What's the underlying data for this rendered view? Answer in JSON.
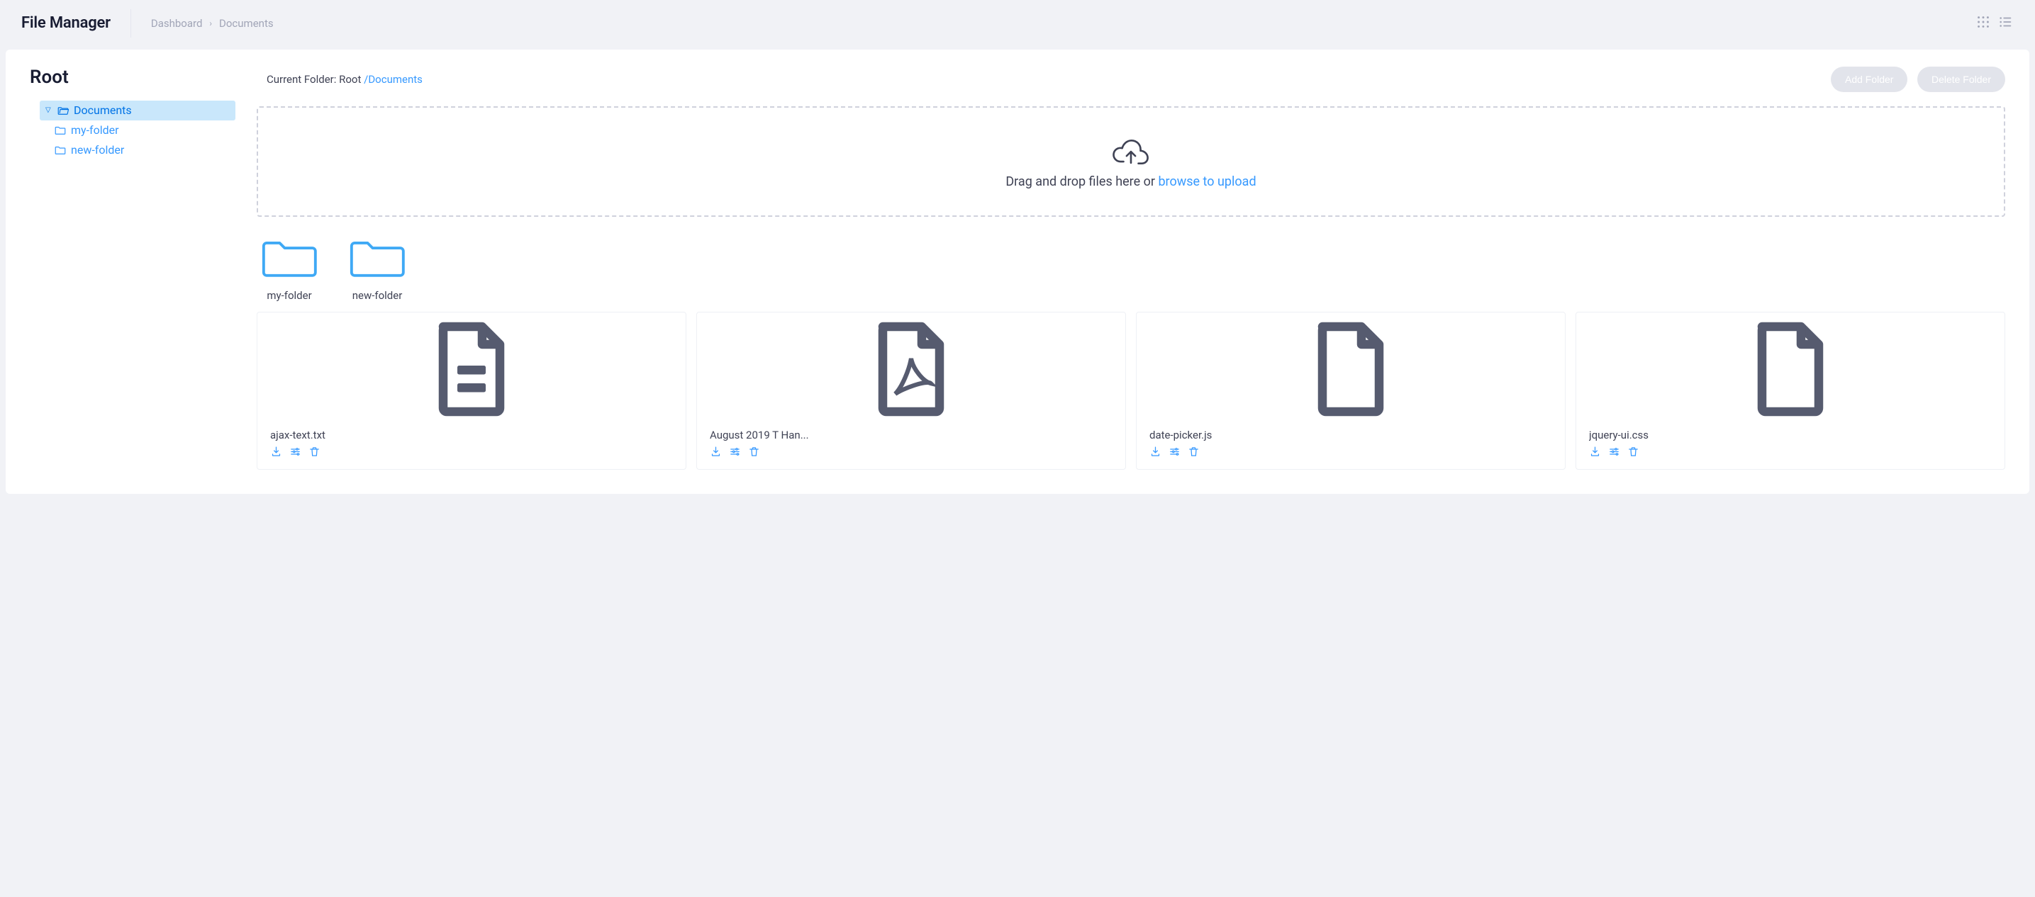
{
  "header": {
    "title": "File Manager",
    "breadcrumb": [
      "Dashboard",
      "Documents"
    ]
  },
  "sidebar": {
    "root_label": "Root",
    "tree": {
      "label": "Documents",
      "selected": true,
      "children": [
        {
          "label": "my-folder"
        },
        {
          "label": "new-folder"
        }
      ]
    }
  },
  "main": {
    "path_prefix": "Current Folder: Root ",
    "path_segments": [
      "Documents"
    ],
    "buttons": {
      "add_folder": "Add Folder",
      "delete_folder": "Delete Folder"
    },
    "dropzone": {
      "text": "Drag and drop files here or ",
      "link": "browse to upload"
    },
    "folders": [
      {
        "name": "my-folder"
      },
      {
        "name": "new-folder"
      }
    ],
    "files": [
      {
        "name": "ajax-text.txt",
        "type": "text"
      },
      {
        "name": "August 2019 T Han...",
        "type": "pdf"
      },
      {
        "name": "date-picker.js",
        "type": "generic"
      },
      {
        "name": "jquery-ui.css",
        "type": "generic"
      }
    ]
  }
}
